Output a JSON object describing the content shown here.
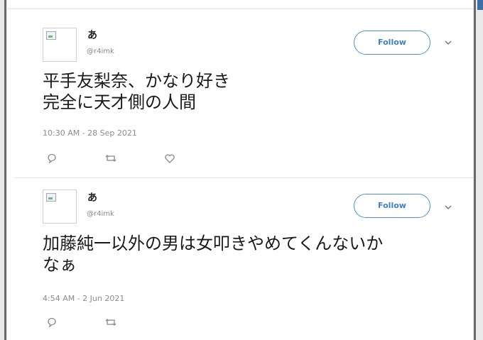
{
  "tweets": [
    {
      "display_name": "あ",
      "handle": "@r4imk",
      "follow_label": "Follow",
      "text_lines": [
        "平手友梨奈、かなり好き",
        "完全に天才側の人間"
      ],
      "timestamp": "10:30 AM - 28 Sep 2021",
      "actions": [
        "reply-icon",
        "retweet-icon",
        "like-icon"
      ]
    },
    {
      "display_name": "あ",
      "handle": "@r4imk",
      "follow_label": "Follow",
      "text_lines": [
        "加藤純一以外の男は女叩きやめてくんないか",
        "なぁ"
      ],
      "timestamp": "4:54 AM - 2 Jun 2021",
      "actions": [
        "reply-icon",
        "retweet-icon"
      ]
    }
  ],
  "colors": {
    "follow_accent": "#4a90d9",
    "text": "#1a1a1a",
    "meta": "#8d8d8d"
  }
}
